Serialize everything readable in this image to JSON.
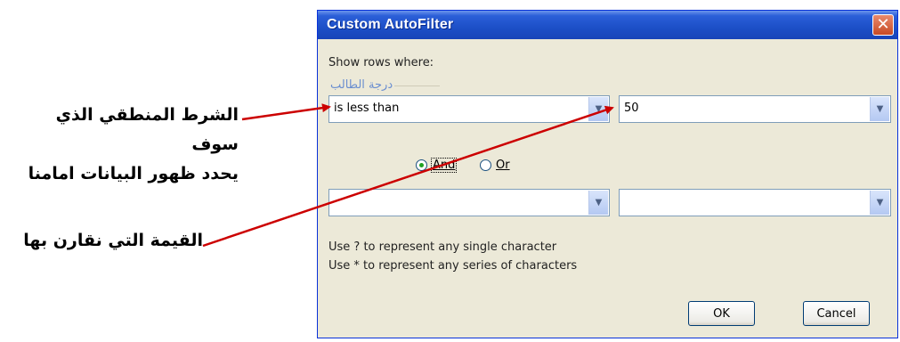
{
  "annotations": {
    "condition_line1": "الشرط المنطقي الذي سوف",
    "condition_line2": "يحدد ظهور البيانات امامنا",
    "value_note": "القيمة التي نقارن بها"
  },
  "dialog": {
    "title": "Custom AutoFilter",
    "close_glyph": "✕",
    "show_rows_label": "Show rows where:",
    "field_name": "درجة الطالب",
    "row1": {
      "operator": "is less than",
      "value": "50"
    },
    "logic": {
      "and_label": "And",
      "or_label": "Or",
      "selected": "And"
    },
    "row2": {
      "operator": "",
      "value": ""
    },
    "hint1": "Use ? to represent any single character",
    "hint2": "Use * to represent any series of characters",
    "ok_label": "OK",
    "cancel_label": "Cancel"
  },
  "colors": {
    "title_bar": "#1c4fc7",
    "dialog_bg": "#ece9d8",
    "arrow": "#cc0000",
    "close_button": "#c74a24"
  },
  "icons": {
    "dropdown": "chevron-down-icon",
    "close": "close-icon"
  }
}
